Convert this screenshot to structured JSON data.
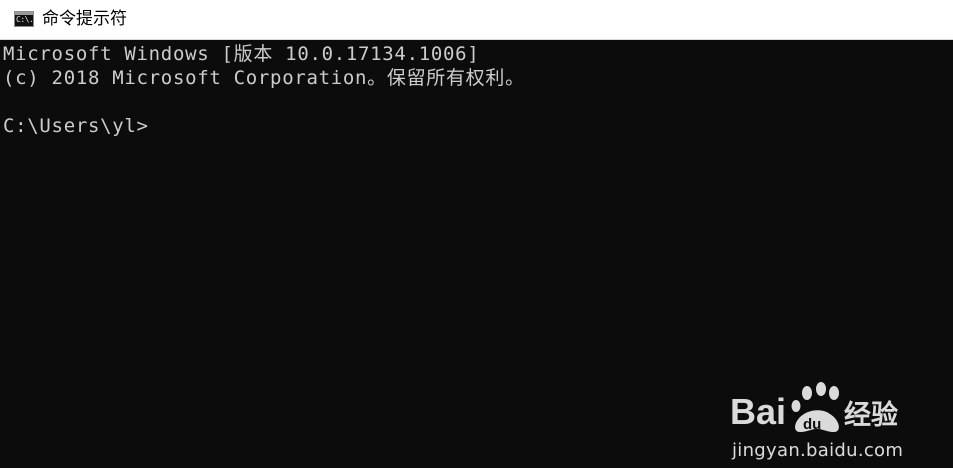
{
  "window": {
    "title": "命令提示符",
    "icon": "cmd-app-icon",
    "icon_glyph": "C:\\."
  },
  "console": {
    "lines": [
      "Microsoft Windows [版本 10.0.17134.1006]",
      "(c) 2018 Microsoft Corporation。保留所有权利。",
      "C:\\Users\\yl>"
    ]
  },
  "watermark": {
    "brand_left": "Bai",
    "brand_paw": "du",
    "brand_right": "经验",
    "url": "jingyan.baidu.com"
  },
  "colors": {
    "console_bg": "#0c0c0c",
    "console_text": "#cccccc",
    "titlebar_bg": "#ffffff"
  }
}
